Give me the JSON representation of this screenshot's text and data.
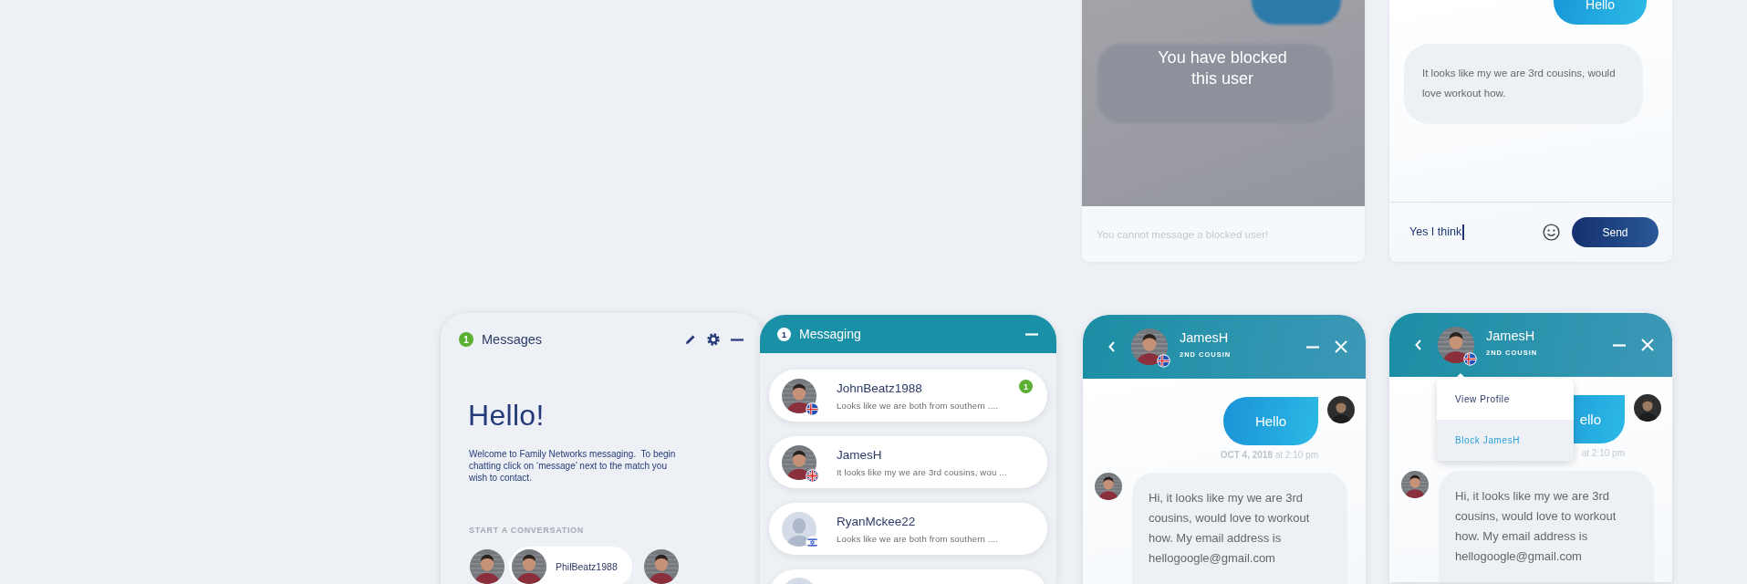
{
  "blocked_chat": {
    "notice": "You have blocked this user",
    "placeholder": "You cannot message a blocked user!"
  },
  "open_chat": {
    "sent_message": "Hello",
    "received_message": "It looks like my we are 3rd cousins, would love workout how.",
    "input_value": "Yes I think",
    "send_button": "Send"
  },
  "messages_panel": {
    "badge": "1",
    "title": "Messages",
    "heading": "Hello!",
    "intro": "Welcome to Family Networks messaging.  To begin chatting click on ‘message’ next to the match you wish to contact.",
    "section_label": "START A CONVERSATION",
    "contacts": [
      {
        "selected": false
      },
      {
        "selected": true,
        "name": "PhilBeatz1988"
      },
      {
        "selected": false
      }
    ]
  },
  "messaging_panel": {
    "badge": "1",
    "title": "Messaging",
    "conversations": [
      {
        "name": "JohnBeatz1988",
        "preview": "Looks like we are both from southern ....",
        "avatar": {
          "kind": "photo"
        },
        "flag": {
          "kind": "iceland"
        },
        "unread": "1"
      },
      {
        "name": "JamesH",
        "preview": "It looks like my we are 3rd cousins, wou ...",
        "avatar": {
          "kind": "photo"
        },
        "flag": {
          "kind": "uk"
        }
      },
      {
        "name": "RyanMckee22",
        "preview": "Looks like we are both from southern ....",
        "avatar": {
          "kind": "placeholder"
        },
        "flag": {
          "kind": "israel"
        }
      },
      {
        "avatar": {
          "kind": "placeholder"
        }
      }
    ]
  },
  "chat_windows": [
    {
      "name": "JamesH",
      "relation": "2ND COUSIN",
      "flag": {
        "kind": "iceland"
      },
      "sent_message": "Hello",
      "timestamp": "**OCT 4, 2018** at 2:10 pm",
      "received_message": "Hi, it looks like my we are 3rd cousins, would love to workout how. My email address is hellogoogle@gmail.com"
    },
    {
      "name": "JamesH",
      "relation": "2ND COUSIN",
      "flag": {
        "kind": "iceland"
      },
      "sent_message": "ello",
      "timestamp": "at 2:10 pm",
      "received_message": "Hi, it looks like my we are 3rd cousins, would love to workout how. My email address is hellogoogle@gmail.com",
      "menu": [
        {
          "label": "View Profile",
          "selected": false
        },
        {
          "label": "Block JamesH",
          "selected": true
        }
      ]
    }
  ]
}
